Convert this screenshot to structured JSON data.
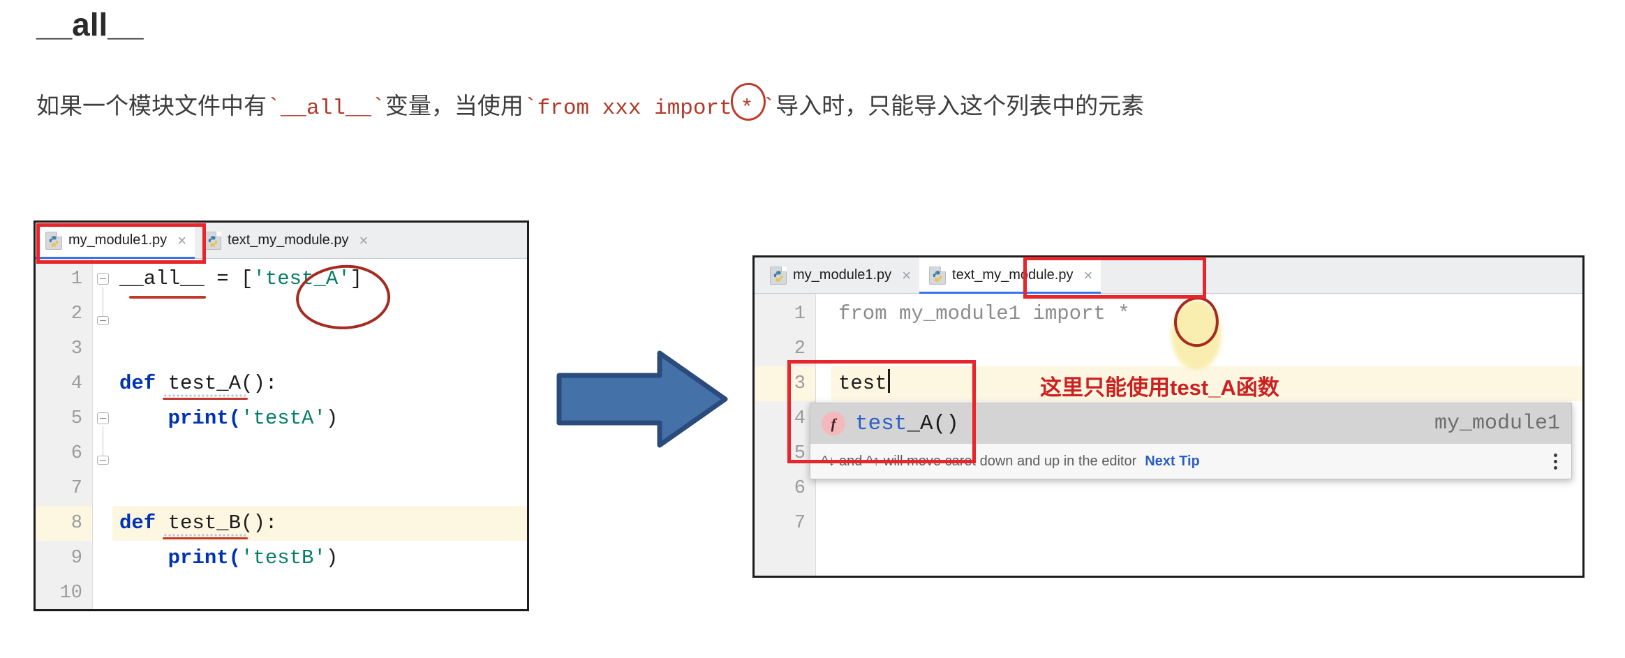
{
  "page": {
    "title": "__all__",
    "intro": {
      "part1": "如果一个模块文件中有",
      "code1": "__all__",
      "part2": "变量，当使用",
      "code2": "from xxx import",
      "star": "*",
      "part3": "导入时，只能导入这个列表中的元素",
      "backtick": "`"
    }
  },
  "left_ide": {
    "tabs": [
      {
        "label": "my_module1.py",
        "icon": "python-file-icon",
        "active": true,
        "close": "×"
      },
      {
        "label": "text_my_module.py",
        "icon": "python-file-icon",
        "active": false,
        "close": "×"
      }
    ],
    "line_numbers": [
      "1",
      "2",
      "3",
      "4",
      "5",
      "6",
      "7",
      "8",
      "9",
      "10"
    ],
    "lines": [
      {
        "n": "1",
        "tokens": [
          {
            "t": "__all__ ",
            "c": "plain"
          },
          {
            "t": "= [",
            "c": "plain"
          },
          {
            "t": "'test_A'",
            "c": "str"
          },
          {
            "t": "]",
            "c": "plain"
          }
        ]
      },
      {
        "n": "2",
        "tokens": []
      },
      {
        "n": "3",
        "tokens": []
      },
      {
        "n": "4",
        "tokens": [
          {
            "t": "def ",
            "c": "kw"
          },
          {
            "t": "test_A():",
            "c": "fn"
          }
        ]
      },
      {
        "n": "5",
        "tokens": [
          {
            "t": "    print(",
            "c": "kw"
          },
          {
            "t": "'testA'",
            "c": "str"
          },
          {
            "t": ")",
            "c": "plain"
          }
        ]
      },
      {
        "n": "6",
        "tokens": []
      },
      {
        "n": "7",
        "tokens": []
      },
      {
        "n": "8",
        "tokens": [
          {
            "t": "def ",
            "c": "kw"
          },
          {
            "t": "test_B():",
            "c": "fn"
          }
        ]
      },
      {
        "n": "9",
        "tokens": [
          {
            "t": "    print(",
            "c": "kw"
          },
          {
            "t": "'testB'",
            "c": "str"
          },
          {
            "t": ")",
            "c": "plain"
          }
        ]
      },
      {
        "n": "10",
        "tokens": []
      }
    ],
    "line1_text": "__all__ = [",
    "line1_str": "'test_A'",
    "line1_tail": "]",
    "line4_kw": "def ",
    "line4_rest": "test_A():",
    "line5_call": "    print(",
    "line5_str": "'testA'",
    "line5_tail": ")",
    "line8_kw": "def ",
    "line8_rest": "test_B():",
    "line9_call": "    print(",
    "line9_str": "'testB'",
    "line9_tail": ")",
    "highlighted_line": "8"
  },
  "right_ide": {
    "tabs": [
      {
        "label": "my_module1.py",
        "icon": "python-file-icon",
        "active": false,
        "close": "×"
      },
      {
        "label": "text_my_module.py",
        "icon": "python-file-icon",
        "active": true,
        "close": "×"
      }
    ],
    "line_numbers": [
      "1",
      "2",
      "3",
      "4",
      "5",
      "6",
      "7"
    ],
    "line1_text": "from my_module1 import ",
    "line1_star": "*",
    "line3_text": "test",
    "highlighted_line": "3",
    "popup": {
      "icon_letter": "f",
      "match_prefix": "test",
      "match_rest": "_A()",
      "origin": "my_module1",
      "hint_text": "^↓ and ^↑ will move caret down and up in the editor",
      "hint_link": "Next Tip",
      "kebab": "more-options"
    },
    "annotation": "这里只能使用test_A函数"
  },
  "arrow": {
    "name": "blue-right-arrow",
    "fill": "#4472a8",
    "stroke": "#2a4b7c"
  },
  "colors": {
    "annotation_red": "#e8252a",
    "hand_drawn_red": "#a62a1f",
    "keyword_blue": "#0033b3",
    "string_green": "#067d68",
    "highlight_yellow": "#fdf7e2",
    "accent_blue": "#3574f0"
  }
}
